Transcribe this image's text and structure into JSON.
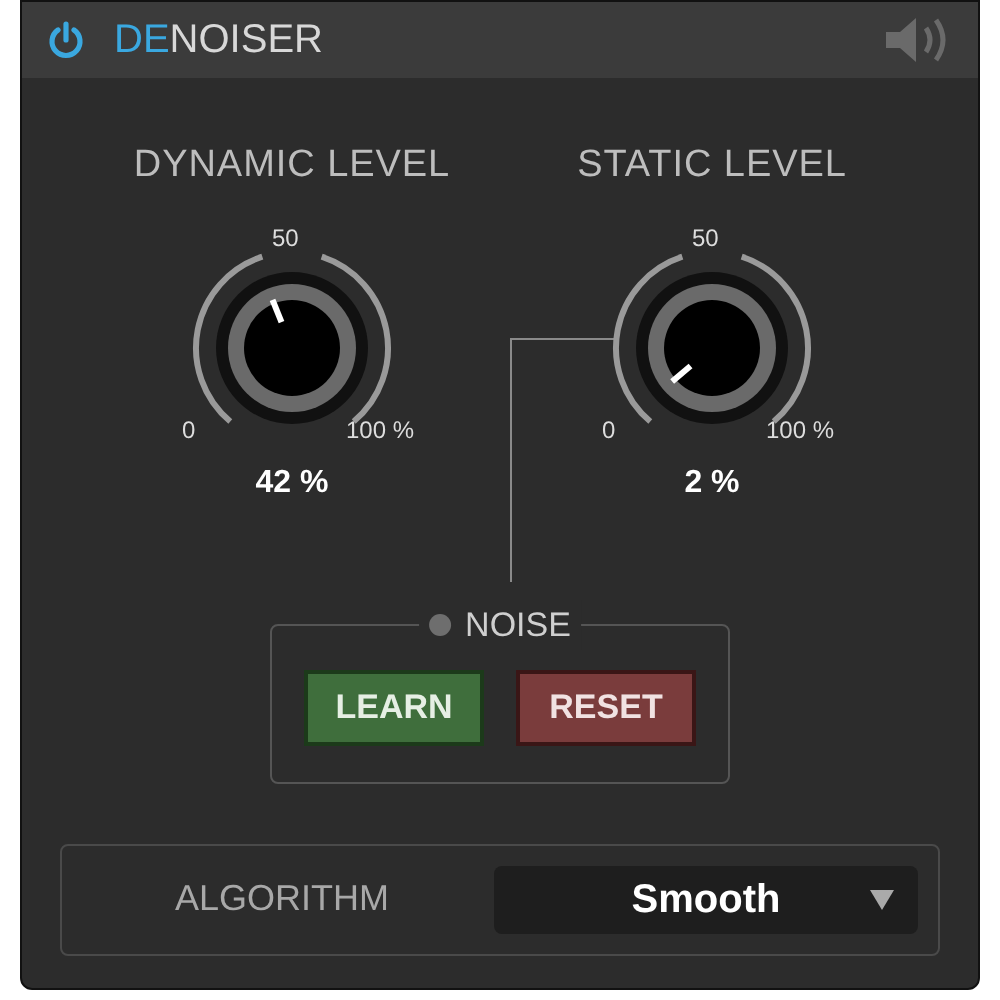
{
  "header": {
    "power_on": true,
    "title_accent": "DE",
    "title_rest": "NOISER"
  },
  "knobs": [
    {
      "label": "DYNAMIC LEVEL",
      "tick_min": "0",
      "tick_mid": "50",
      "tick_max": "100 %",
      "reading": "42 %"
    },
    {
      "label": "STATIC LEVEL",
      "tick_min": "0",
      "tick_mid": "50",
      "tick_max": "100 %",
      "reading": "2 %"
    }
  ],
  "noise": {
    "title": "NOISE",
    "led_on": false,
    "buttons": [
      {
        "label": "LEARN",
        "kind": "learn"
      },
      {
        "label": "RESET",
        "kind": "reset"
      }
    ]
  },
  "algorithm": {
    "label": "ALGORITHM",
    "value": "Smooth"
  }
}
